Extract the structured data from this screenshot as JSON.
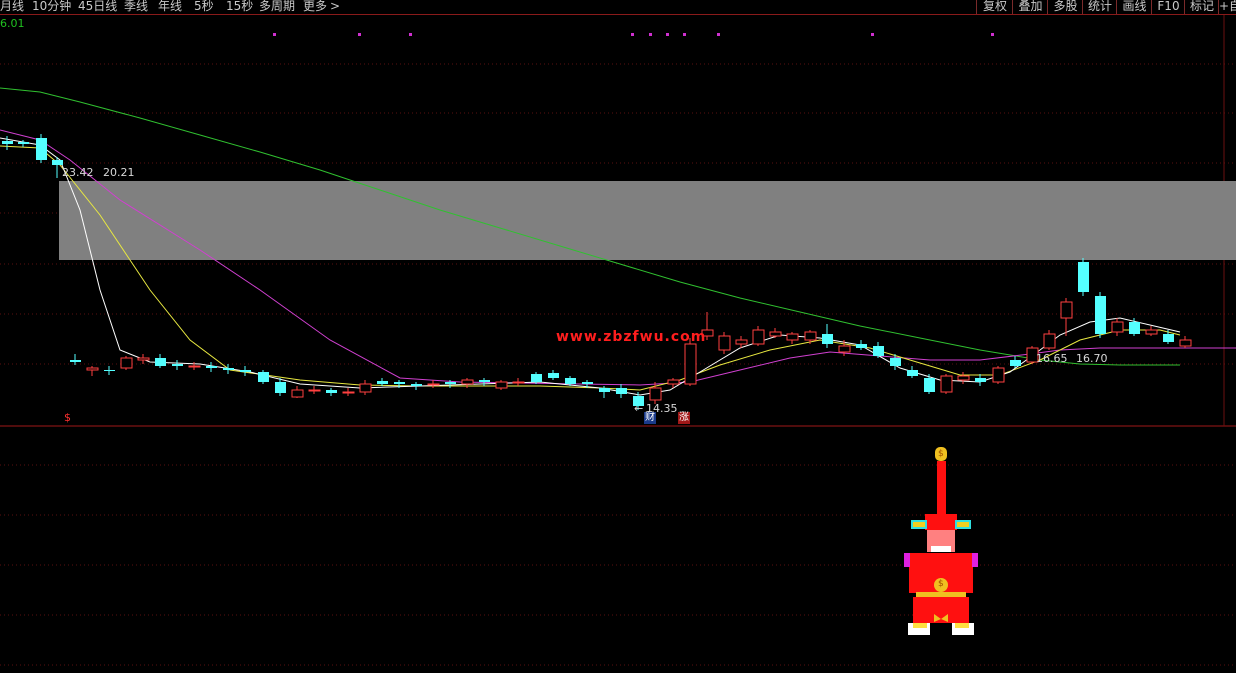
{
  "toolbar": {
    "left_items": [
      "月线",
      "10分钟",
      "45日线",
      "季线",
      "年线",
      "5秒",
      "15秒",
      "多周期",
      "更多"
    ],
    "more_arrow": ">",
    "right_items": [
      "复权",
      "叠加",
      "多股",
      "统计",
      "画线",
      "F10",
      "标记",
      "+自"
    ]
  },
  "chart": {
    "top_price_label": "6.01",
    "high_label_left": "23.42",
    "high_label_right": "20.21",
    "low_label": "14.35",
    "low_label_arrow": "←",
    "right_label_left": "16.65",
    "right_label_right": "16.70",
    "watermark": "www.zbzfwu.com",
    "badge_cai": "财",
    "badge_zhang": "涨",
    "signal_mark": "$",
    "band_color": "#808080",
    "ma_colors": {
      "white": "#ffffff",
      "yellow": "#e8e840",
      "magenta": "#d040d0",
      "green": "#30c030"
    },
    "up_color": "#ff4040",
    "down_color": "#54ffff"
  },
  "mascot": {
    "money_bag_glyph": "$",
    "belly_glyph": "$"
  }
}
